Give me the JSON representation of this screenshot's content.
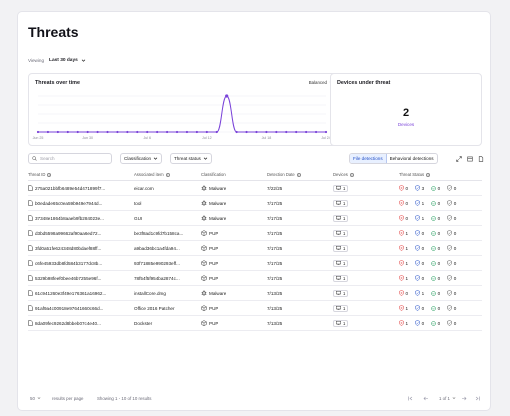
{
  "page": {
    "title": "Threats"
  },
  "viewing": {
    "label": "Viewing",
    "value": "Last 30 days"
  },
  "chart_card": {
    "title": "Threats over time",
    "mode": "Balanced"
  },
  "devices_card": {
    "title": "Devices under threat",
    "count": "2",
    "label": "Devices"
  },
  "colors": {
    "accent": "#7a43d9",
    "primary": "#2450c8",
    "danger": "#e03a3a",
    "success": "#1e9a5a"
  },
  "chart_data": {
    "type": "line",
    "title": "Threats over time",
    "x": [
      "Jun 25",
      "Jun 26",
      "Jun 27",
      "Jun 28",
      "Jun 29",
      "Jun 30",
      "Jul 1",
      "Jul 2",
      "Jul 3",
      "Jul 4",
      "Jul 5",
      "Jul 6",
      "Jul 7",
      "Jul 8",
      "Jul 9",
      "Jul 10",
      "Jul 11",
      "Jul 12",
      "Jul 13",
      "Jul 14",
      "Jul 15",
      "Jul 16",
      "Jul 17",
      "Jul 18",
      "Jul 19",
      "Jul 20",
      "Jul 21",
      "Jul 22",
      "Jul 23",
      "Jul 24"
    ],
    "tick_labels": [
      "Jun 25",
      "Jun 30",
      "Jul 6",
      "Jul 12",
      "Jul 18",
      "Jul 24"
    ],
    "values": [
      0,
      0,
      0,
      0,
      0,
      0,
      0,
      0,
      0,
      0,
      0,
      0,
      0,
      0,
      0,
      0,
      0,
      0,
      0,
      8,
      0,
      0,
      0,
      0,
      0,
      0,
      0,
      0,
      0,
      0
    ],
    "ylim": [
      0,
      8
    ],
    "grid": true,
    "color": "#7a43d9"
  },
  "toolbar": {
    "search_placeholder": "Search",
    "filter_classification": "Classification",
    "filter_status": "Threat status",
    "tab_file": "File detections",
    "tab_behavioral": "Behavioral detections"
  },
  "table": {
    "headers": [
      "Threat ID",
      "Associated item",
      "Classification",
      "Detection Date",
      "Devices",
      "Threat Status"
    ],
    "rows": [
      {
        "id": "275a021bbfb6489e54d471899f7...",
        "item": "eicar.com",
        "class": "Malware",
        "date": "7/22/25",
        "devices": "1",
        "s": [
          "0",
          "3",
          "0",
          "0"
        ]
      },
      {
        "id": "b0edade65c0ea59b949e7944d...",
        "item": "tool",
        "class": "Malware",
        "date": "7/17/25",
        "devices": "1",
        "s": [
          "0",
          "1",
          "0",
          "0"
        ]
      },
      {
        "id": "37348e1864b8aaeb9fb284023e...",
        "item": "GUI",
        "class": "Malware",
        "date": "7/17/25",
        "devices": "1",
        "s": [
          "0",
          "1",
          "0",
          "0"
        ]
      },
      {
        "id": "d3bd5598a99662af90aa6ed72...",
        "item": "be3f8ad1c9fd7b158ca...",
        "class": "PUP",
        "date": "7/17/25",
        "devices": "1",
        "s": [
          "1",
          "0",
          "0",
          "0"
        ]
      },
      {
        "id": "3fd0a51fe624348d80bdaef88ff...",
        "item": "a9bad36bc1a4fda94...",
        "class": "PUP",
        "date": "7/17/25",
        "devices": "1",
        "s": [
          "1",
          "0",
          "0",
          "0"
        ]
      },
      {
        "id": "c6fe45933db8fd584b3177dc8b...",
        "item": "93f71885e990293eff...",
        "class": "PUP",
        "date": "7/17/25",
        "devices": "1",
        "s": [
          "1",
          "0",
          "0",
          "0"
        ]
      },
      {
        "id": "5329b98feef0bee46b7255e96f...",
        "item": "78f54f5f954ba2874c...",
        "class": "PUP",
        "date": "7/17/25",
        "devices": "1",
        "s": [
          "1",
          "0",
          "0",
          "0"
        ]
      },
      {
        "id": "61c941260e3f49e176361a16962...",
        "item": "installCore.dmg",
        "class": "Malware",
        "date": "7/13/25",
        "devices": "1",
        "s": [
          "0",
          "1",
          "0",
          "0"
        ]
      },
      {
        "id": "91af9a4c00918e97641660c66d...",
        "item": "Office 2016 Patcher",
        "class": "PUP",
        "date": "7/13/25",
        "devices": "1",
        "s": [
          "1",
          "0",
          "0",
          "0"
        ]
      },
      {
        "id": "8da09fec9262d8bbeb07c4e40...",
        "item": "Dockster",
        "class": "PUP",
        "date": "7/13/25",
        "devices": "1",
        "s": [
          "1",
          "0",
          "0",
          "0"
        ]
      }
    ]
  },
  "footer": {
    "per_page": "50",
    "per_page_label": "results per page",
    "showing": "Showing 1 - 10 of 10 results",
    "page_info": "1 of 1"
  }
}
